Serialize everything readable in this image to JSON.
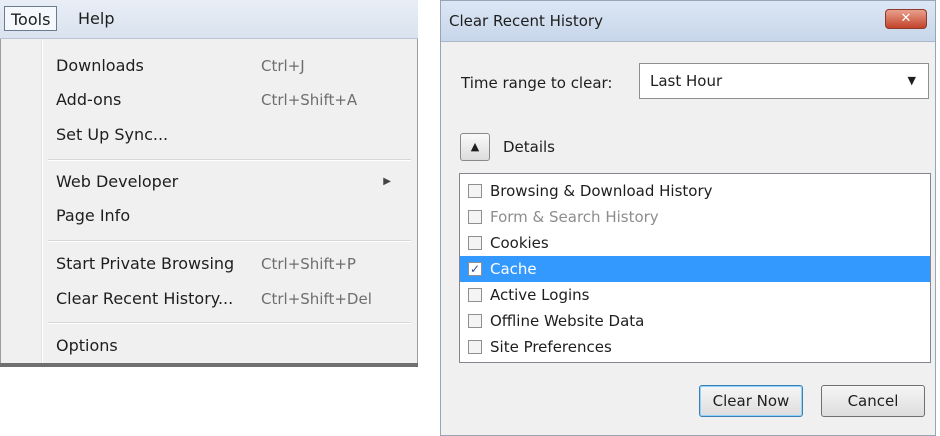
{
  "menubar": {
    "tools": "Tools",
    "help": "Help"
  },
  "tools_menu": {
    "items": [
      {
        "label": "Downloads",
        "shortcut": "Ctrl+J"
      },
      {
        "label": "Add-ons",
        "shortcut": "Ctrl+Shift+A"
      },
      {
        "label": "Set Up Sync...",
        "shortcut": ""
      },
      {
        "label": "Web Developer",
        "shortcut": ""
      },
      {
        "label": "Page Info",
        "shortcut": ""
      },
      {
        "label": "Start Private Browsing",
        "shortcut": "Ctrl+Shift+P"
      },
      {
        "label": "Clear Recent History...",
        "shortcut": "Ctrl+Shift+Del"
      },
      {
        "label": "Options",
        "shortcut": ""
      }
    ],
    "submenu_arrow": "▶"
  },
  "dialog": {
    "title": "Clear Recent History",
    "close_glyph": "✕",
    "time_range_label": "Time range to clear:",
    "time_range_value": "Last Hour",
    "select_arrow": "▼",
    "details_toggle_glyph": "▲",
    "details_label": "Details",
    "items": [
      {
        "label": "Browsing & Download History",
        "checked": false,
        "disabled": false
      },
      {
        "label": "Form & Search History",
        "checked": false,
        "disabled": true
      },
      {
        "label": "Cookies",
        "checked": false,
        "disabled": false
      },
      {
        "label": "Cache",
        "checked": true,
        "disabled": false,
        "selected": true
      },
      {
        "label": "Active Logins",
        "checked": false,
        "disabled": false
      },
      {
        "label": "Offline Website Data",
        "checked": false,
        "disabled": false
      },
      {
        "label": "Site Preferences",
        "checked": false,
        "disabled": false
      }
    ],
    "check_glyph": "✓",
    "clear_now_label": "Clear Now",
    "cancel_label": "Cancel"
  },
  "colors": {
    "selection": "#3399ff",
    "menu_bg": "#f0f0f0",
    "close_button": "#c2432a"
  }
}
